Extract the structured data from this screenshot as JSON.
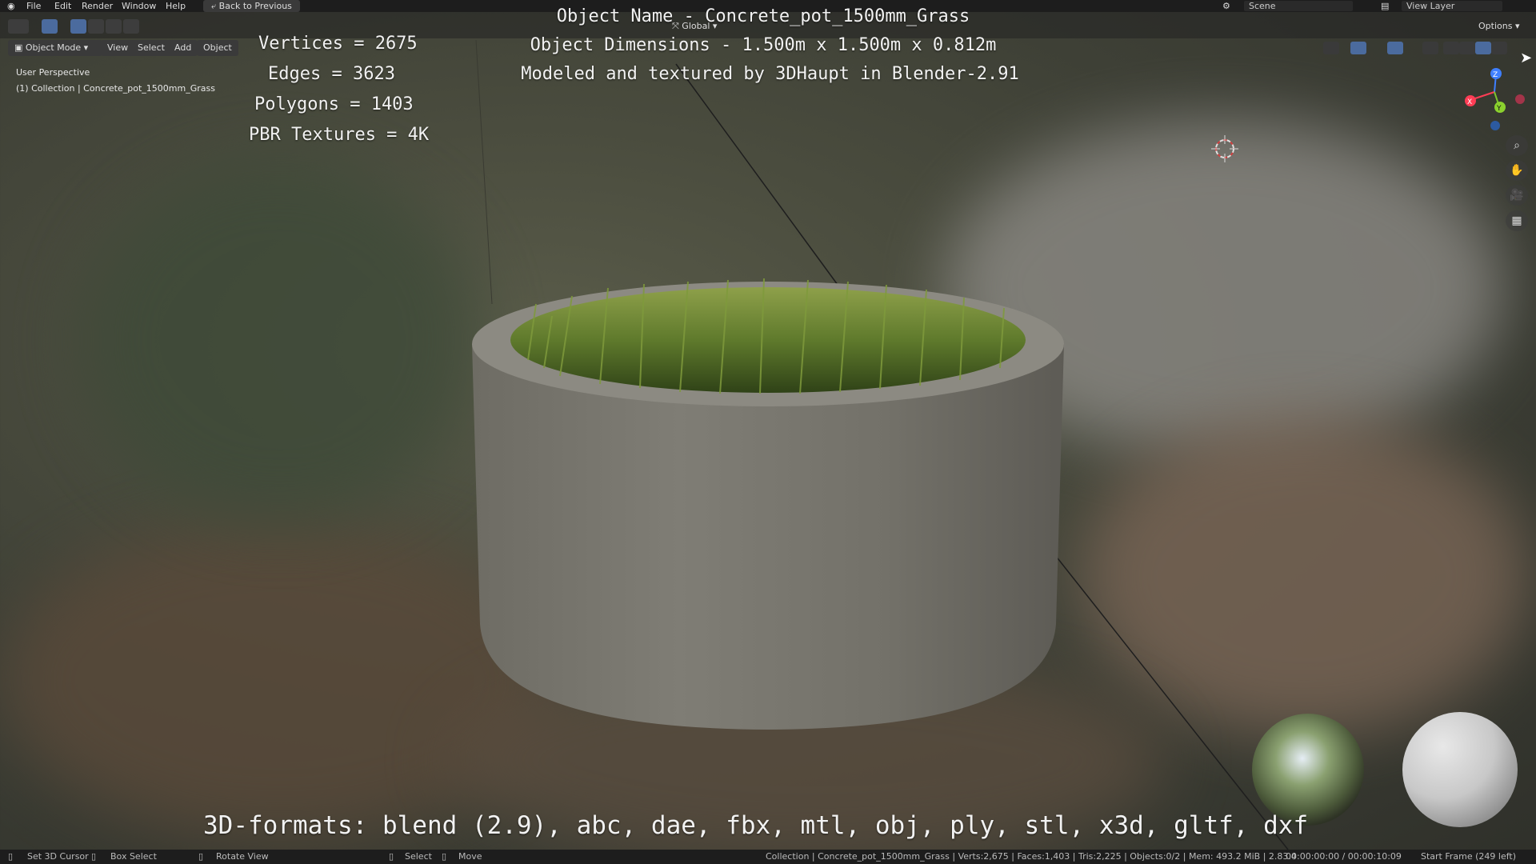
{
  "menubar": {
    "items": [
      "File",
      "Edit",
      "Render",
      "Window",
      "Help"
    ],
    "back_button": "Back to Previous",
    "scene": "Scene",
    "view_layer": "View Layer"
  },
  "toolheader": {
    "transform_orientation": "Global",
    "options": "Options"
  },
  "viewport_header": {
    "mode": "Object Mode",
    "menus": [
      "View",
      "Select",
      "Add",
      "Object"
    ]
  },
  "viewport_info": {
    "perspective": "User Perspective",
    "collection": "(1) Collection | Concrete_pot_1500mm_Grass"
  },
  "overlay": {
    "stats": [
      "Vertices = 2675",
      "Edges = 3623",
      "Polygons = 1403",
      "PBR Textures = 4K"
    ],
    "object_name": "Object Name - Concrete_pot_1500mm_Grass",
    "dimensions": "Object Dimensions -  1.500m x 1.500m x 0.812m",
    "credit": "Modeled and textured by 3DHaupt in Blender-2.91",
    "formats": "3D-formats: blend (2.9), abc, dae, fbx, mtl, obj, ply, stl, x3d, gltf, dxf"
  },
  "statusbar": {
    "set_cursor": "Set 3D Cursor",
    "box_select": "Box Select",
    "rotate_view": "Rotate View",
    "select": "Select",
    "move": "Move",
    "stats": "Collection | Concrete_pot_1500mm_Grass | Verts:2,675 | Faces:1,403 | Tris:2,225 | Objects:0/2 | Mem: 493.2 MiB | 2.83.4",
    "time": "00:00:00:00 / 00:00:10:09",
    "frame": "Start Frame (249 left)"
  },
  "gizmo": {
    "x": "X",
    "y": "Y",
    "z": "Z"
  }
}
